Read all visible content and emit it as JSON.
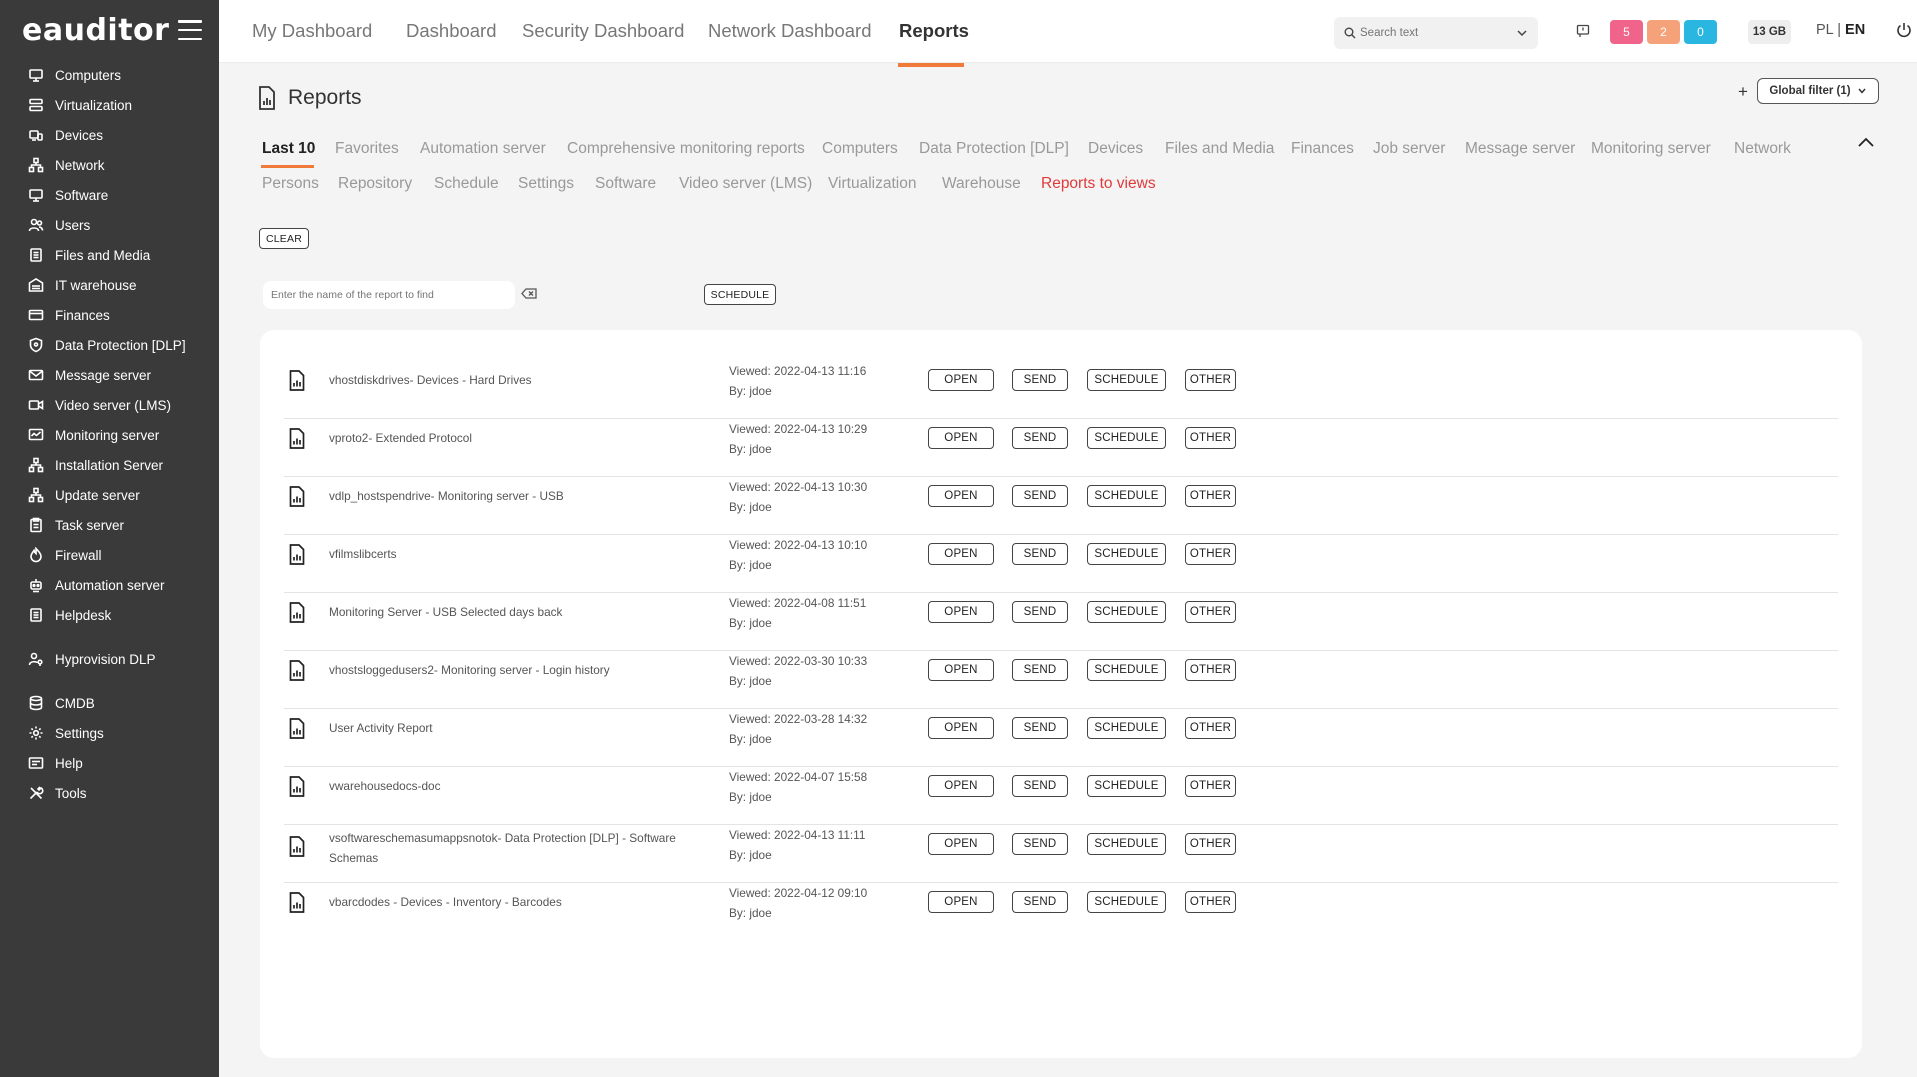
{
  "app": {
    "logo": "eauditor",
    "logo_icon": "hamburger-icon"
  },
  "sidebar": {
    "items": [
      {
        "label": "Computers",
        "icon": "monitor-icon"
      },
      {
        "label": "Virtualization",
        "icon": "server-icon"
      },
      {
        "label": "Devices",
        "icon": "devices-icon"
      },
      {
        "label": "Network",
        "icon": "network-icon"
      },
      {
        "label": "Software",
        "icon": "monitor-icon"
      },
      {
        "label": "Users",
        "icon": "users-icon"
      },
      {
        "label": "Files and Media",
        "icon": "files-icon"
      },
      {
        "label": "IT warehouse",
        "icon": "warehouse-icon"
      },
      {
        "label": "Finances",
        "icon": "card-icon"
      },
      {
        "label": "Data Protection [DLP]",
        "icon": "shield-icon"
      },
      {
        "label": "Message server",
        "icon": "mail-icon"
      },
      {
        "label": "Video server (LMS)",
        "icon": "video-icon"
      },
      {
        "label": "Monitoring server",
        "icon": "monitoring-icon"
      },
      {
        "label": "Installation Server",
        "icon": "network-icon"
      },
      {
        "label": "Update server",
        "icon": "network-icon"
      },
      {
        "label": "Task server",
        "icon": "clipboard-icon"
      },
      {
        "label": "Firewall",
        "icon": "firewall-icon"
      },
      {
        "label": "Automation server",
        "icon": "robot-icon"
      },
      {
        "label": "Helpdesk",
        "icon": "files-icon"
      }
    ],
    "items2": [
      {
        "label": "Hyprovision DLP",
        "icon": "user-key-icon"
      }
    ],
    "items3": [
      {
        "label": "CMDB",
        "icon": "database-icon"
      },
      {
        "label": "Settings",
        "icon": "gear-icon"
      },
      {
        "label": "Help",
        "icon": "help-icon"
      },
      {
        "label": "Tools",
        "icon": "tools-icon"
      }
    ]
  },
  "topbar": {
    "tabs": [
      "My Dashboard",
      "Dashboard",
      "Security Dashboard",
      "Network Dashboard",
      "Reports"
    ],
    "active_tab": "Reports",
    "search_placeholder": "Search text",
    "badges": [
      {
        "value": "5",
        "color": "#f0648c"
      },
      {
        "value": "2",
        "color": "#f5a27a"
      },
      {
        "value": "0",
        "color": "#29b6e0"
      }
    ],
    "storage": "13 GB",
    "lang_pl": "PL",
    "lang_sep": " | ",
    "lang_en": "EN"
  },
  "page": {
    "title": "Reports",
    "global_filter": "Global filter (1)",
    "categories_row1": [
      "Last 10",
      "Favorites",
      "Automation server",
      "Comprehensive monitoring reports",
      "Computers",
      "Data Protection [DLP]",
      "Devices",
      "Files and Media",
      "Finances",
      "Job server",
      "Message server",
      "Monitoring server",
      "Network"
    ],
    "categories_row2": [
      "Persons",
      "Repository",
      "Schedule",
      "Settings",
      "Software",
      "Video server (LMS)",
      "Virtualization",
      "Warehouse",
      "Reports to views"
    ],
    "active_category": "Last 10",
    "clear_label": "CLEAR",
    "find_placeholder": "Enter the name of the report to find",
    "schedule_label": "SCHEDULE"
  },
  "reports": [
    {
      "name": "vhostdiskdrives- Devices - Hard Drives",
      "viewed": "Viewed: 2022-04-13 11:16",
      "by": "By: jdoe"
    },
    {
      "name": "vproto2- Extended Protocol",
      "viewed": "Viewed: 2022-04-13 10:29",
      "by": "By: jdoe"
    },
    {
      "name": "vdlp_hostspendrive- Monitoring server - USB",
      "viewed": "Viewed: 2022-04-13 10:30",
      "by": "By: jdoe"
    },
    {
      "name": "vfilmslibcerts",
      "viewed": "Viewed: 2022-04-13 10:10",
      "by": "By: jdoe"
    },
    {
      "name": "Monitoring Server - USB Selected days back",
      "viewed": "Viewed: 2022-04-08 11:51",
      "by": "By: jdoe"
    },
    {
      "name": "vhostsloggedusers2- Monitoring server - Login history",
      "viewed": "Viewed: 2022-03-30 10:33",
      "by": "By: jdoe"
    },
    {
      "name": "User Activity Report",
      "viewed": "Viewed: 2022-03-28 14:32",
      "by": "By: jdoe"
    },
    {
      "name": "vwarehousedocs-doc",
      "viewed": "Viewed: 2022-04-07 15:58",
      "by": "By: jdoe"
    },
    {
      "name": "vsoftwareschemasumappsnotok- Data Protection [DLP] - Software Schemas",
      "viewed": "Viewed: 2022-04-13 11:11",
      "by": "By: jdoe"
    },
    {
      "name": "vbarcdodes - Devices - Inventory - Barcodes",
      "viewed": "Viewed: 2022-04-12 09:10",
      "by": "By: jdoe"
    }
  ],
  "row_actions": {
    "open": "OPEN",
    "send": "SEND",
    "schedule": "SCHEDULE",
    "other": "OTHER"
  },
  "colors": {
    "accent": "#f07a3a",
    "sidebar_bg": "#3a3a3a",
    "link_red": "#e03a3a"
  }
}
